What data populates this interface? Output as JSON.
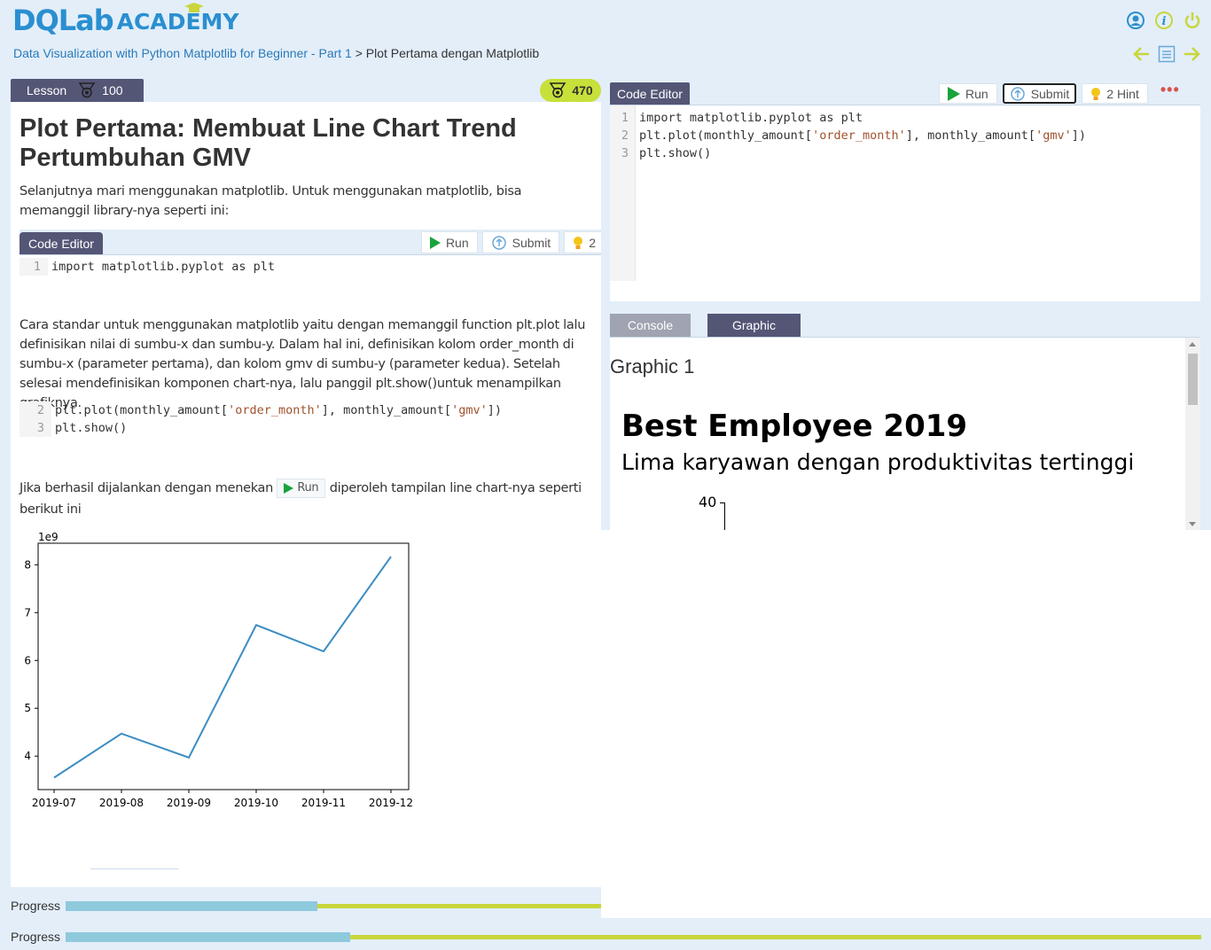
{
  "header": {
    "logo_main": "DQLab",
    "logo_sub": "ACADEMY",
    "icons": [
      "user-circle-icon",
      "info-icon",
      "power-icon"
    ]
  },
  "breadcrumb": {
    "course": "Data Visualization with Python Matplotlib for Beginner - Part 1",
    "separator": ">",
    "current": "Plot Pertama dengan Matplotlib"
  },
  "nav": {
    "icons": [
      "arrow-left-icon",
      "list-icon",
      "arrow-right-icon"
    ]
  },
  "lesson": {
    "tab_label": "Lesson",
    "xp": "100",
    "total_score": "470",
    "title": "Plot Pertama: Membuat Line Chart Trend Pertumbuhan GMV",
    "para1": "Selanjutnya mari menggunakan matplotlib. Untuk menggunakan matplotlib, bisa memanggil library-nya seperti ini:",
    "mini_editor": {
      "tab": "Code Editor",
      "run": "Run",
      "submit": "Submit",
      "hint": "2",
      "lines": [
        {
          "no": "1",
          "code": "import matplotlib.pyplot as plt"
        }
      ]
    },
    "para2": "Cara standar untuk menggunakan matplotlib yaitu dengan memanggil function plt.plot lalu definisikan nilai di sumbu-x dan sumbu-y. Dalam hal ini, definisikan kolom order_month di sumbu-x (parameter pertama), dan kolom gmv di sumbu-y (parameter kedua). Setelah selesai mendefinisikan komponen chart-nya, lalu panggil plt.show()untuk menampilkan grafiknya.",
    "code_block": [
      {
        "no": "2",
        "pre": "plt.plot(monthly_amount[",
        "s1": "'order_month'",
        "mid": "], monthly_amount[",
        "s2": "'gmv'",
        "post": "])"
      },
      {
        "no": "3",
        "code": "plt.show()"
      }
    ],
    "para3_a": "Jika berhasil dijalankan dengan menekan",
    "para3_btn": "Run",
    "para3_b": "diperoleh tampilan line chart-nya seperti berikut ini"
  },
  "chart_data": {
    "type": "line",
    "categories": [
      "2019-07",
      "2019-08",
      "2019-09",
      "2019-10",
      "2019-11",
      "2019-12"
    ],
    "values": [
      3.55,
      4.47,
      3.97,
      6.74,
      6.19,
      8.17
    ],
    "yticks": [
      "4",
      "5",
      "6",
      "7",
      "8"
    ],
    "offset_label": "1e9",
    "ylim": [
      3.3,
      8.45
    ],
    "color": "#3c8dc4"
  },
  "progress": {
    "label1": "Progress",
    "label2": "Progress",
    "fraction": 0.47,
    "fill_color": "#8ec9dc",
    "track_color": "#c8d63a"
  },
  "editor": {
    "tab": "Code Editor",
    "run": "Run",
    "submit": "Submit",
    "hint": "2 Hint",
    "more": "•••",
    "lines": [
      {
        "no": "1",
        "code": "import matplotlib.pyplot as plt"
      },
      {
        "no": "2",
        "pre": "plt.plot(monthly_amount[",
        "s1": "'order_month'",
        "mid": "], monthly_amount[",
        "s2": "'gmv'",
        "post": "])"
      },
      {
        "no": "3",
        "code": "plt.show()"
      }
    ]
  },
  "output": {
    "tab_console": "Console",
    "tab_graphic": "Graphic",
    "graphic_label": "Graphic 1",
    "figure_title": "Best Employee 2019",
    "figure_subtitle": "Lima karyawan dengan produktivitas tertinggi",
    "first_tick": "40"
  }
}
